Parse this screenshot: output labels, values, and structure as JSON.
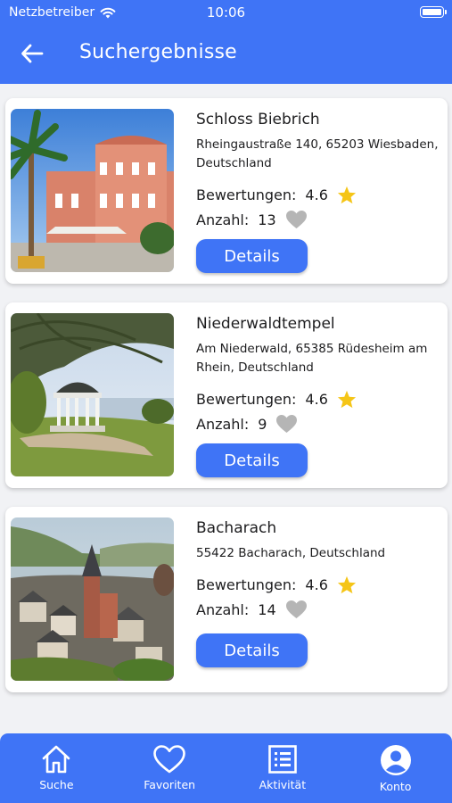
{
  "status_bar": {
    "carrier": "Netzbetreiber",
    "time": "10:06"
  },
  "header": {
    "title": "Suchergebnisse",
    "back_icon": "arrow-left-icon"
  },
  "colors": {
    "primary": "#3f74f6",
    "star": "#f5c517",
    "heart": "#b5b5b5"
  },
  "results": [
    {
      "name": "Schloss Biebrich",
      "address": "Rheingaustraße 140, 65203 Wiesbaden, Deutschland",
      "rating_label": "Bewertungen:",
      "rating": "4.6",
      "count_label": "Anzahl:",
      "count": "13",
      "details_label": "Details"
    },
    {
      "name": "Niederwaldtempel",
      "address": "Am Niederwald, 65385 Rüdesheim am Rhein, Deutschland",
      "rating_label": "Bewertungen:",
      "rating": "4.6",
      "count_label": "Anzahl:",
      "count": "9",
      "details_label": "Details"
    },
    {
      "name": "Bacharach",
      "address": "55422 Bacharach, Deutschland",
      "rating_label": "Bewertungen:",
      "rating": "4.6",
      "count_label": "Anzahl:",
      "count": "14",
      "details_label": "Details"
    }
  ],
  "tabbar": {
    "items": [
      {
        "label": "Suche",
        "icon": "home-icon"
      },
      {
        "label": "Favoriten",
        "icon": "heart-icon"
      },
      {
        "label": "Aktivität",
        "icon": "list-icon"
      },
      {
        "label": "Konto",
        "icon": "account-icon"
      }
    ]
  }
}
